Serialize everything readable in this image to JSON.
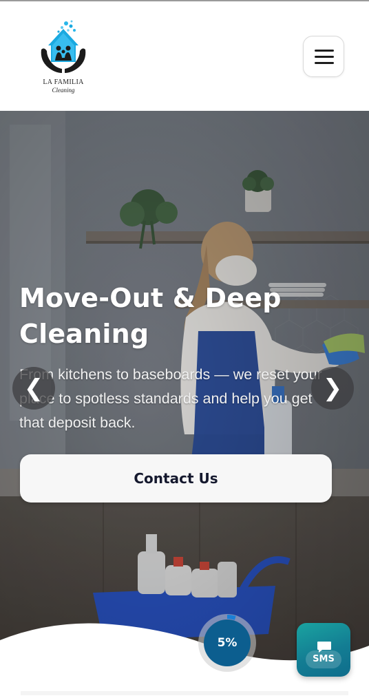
{
  "brand": {
    "name": "LA FAMILIA",
    "subtitle": "Cleaning",
    "logo_icon": "house-hands-logo",
    "colors": {
      "logo_blue": "#1aa9e0",
      "logo_dark": "#1b1b1b"
    }
  },
  "header": {
    "menu_icon": "hamburger-menu-icon"
  },
  "hero": {
    "title": "Move-Out & Deep Cleaning",
    "description": "From kitchens to baseboards — we reset your place to spotless standards and help you get that deposit back.",
    "cta_label": "Contact Us",
    "prev_arrow": "❮",
    "next_arrow": "❯"
  },
  "scroll_progress": {
    "label": "5%",
    "value": 0.05,
    "color": "#0c5e8f"
  },
  "sms_button": {
    "label": "SMS",
    "icon": "chat-bubble-icon",
    "color": "#137d93"
  }
}
